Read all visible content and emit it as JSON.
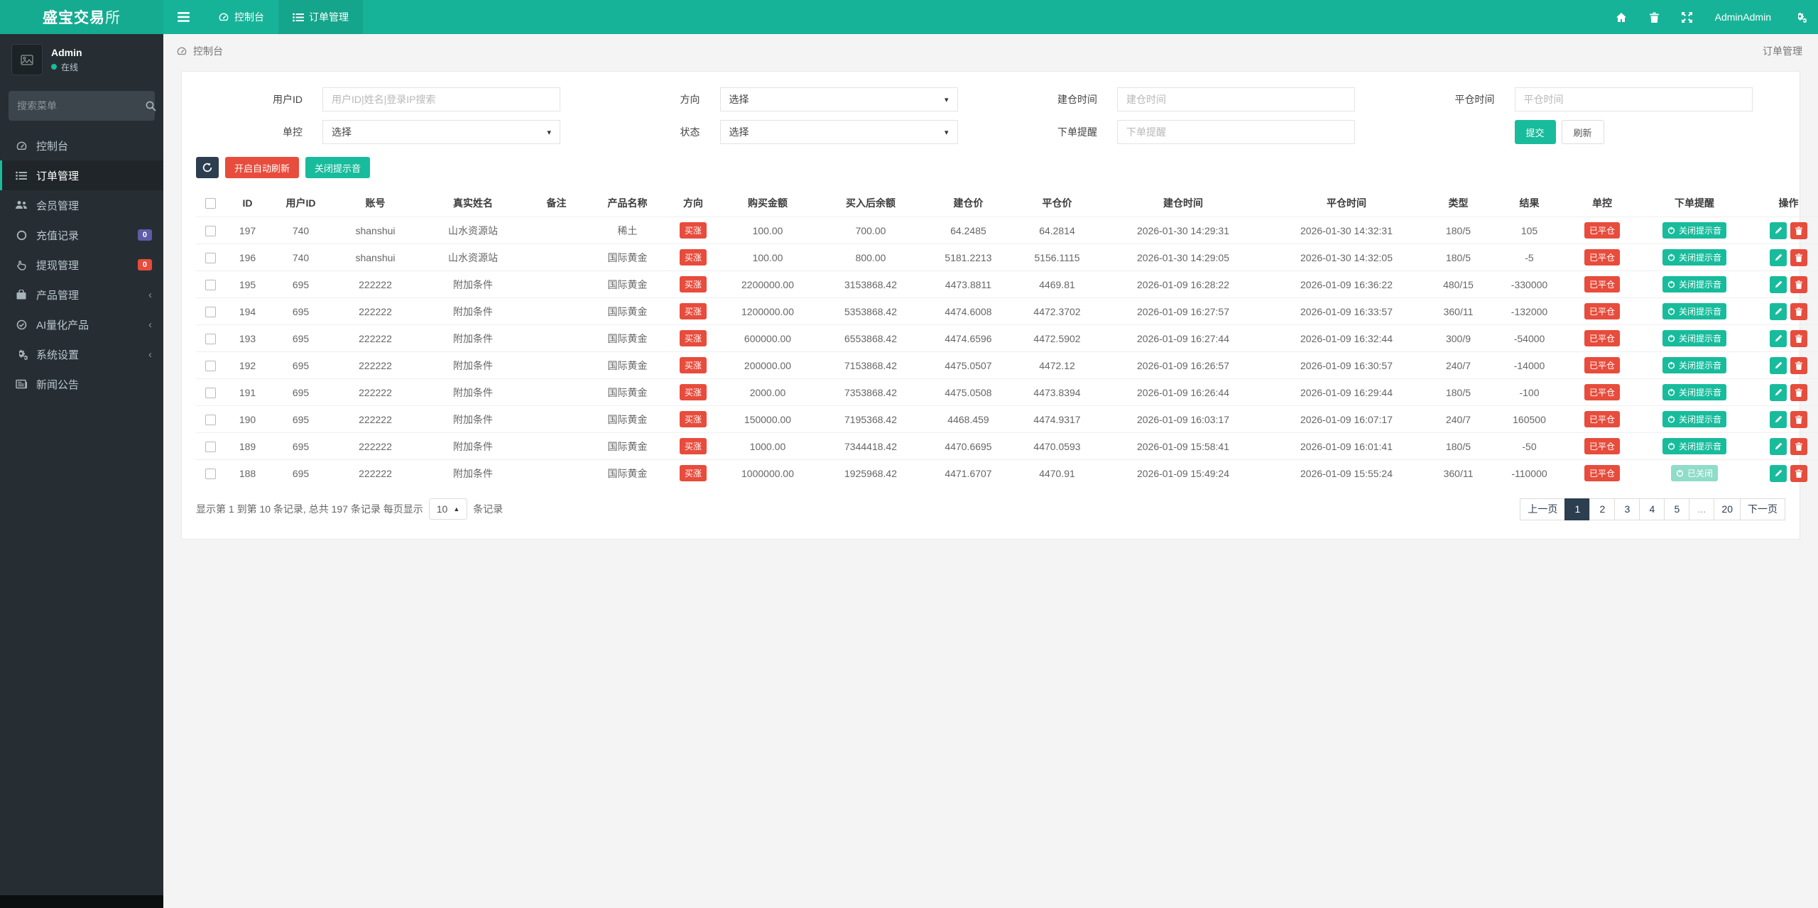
{
  "colors": {
    "teal": "#18bc9c",
    "navbar": "#17b398",
    "navy": "#2c3e50",
    "red": "#e74c3c",
    "purple": "#605ca8",
    "sidebar": "#272e33"
  },
  "brand": {
    "bold": "盛宝交易",
    "light": "所"
  },
  "navbar": {
    "tabs": [
      {
        "label": "控制台"
      },
      {
        "label": "订单管理"
      }
    ],
    "user": "AdminAdmin"
  },
  "profile": {
    "name": "Admin",
    "status": "在线"
  },
  "sidebar": {
    "search_placeholder": "搜索菜单",
    "items": [
      {
        "label": "控制台"
      },
      {
        "label": "订单管理"
      },
      {
        "label": "会员管理"
      },
      {
        "label": "充值记录",
        "badge": "0"
      },
      {
        "label": "提现管理",
        "badge": "0"
      },
      {
        "label": "产品管理"
      },
      {
        "label": "AI量化产品"
      },
      {
        "label": "系统设置"
      },
      {
        "label": "新闻公告"
      }
    ]
  },
  "breadcrumb": {
    "left": "控制台",
    "right": "订单管理"
  },
  "filters": {
    "user_id": {
      "label": "用户ID",
      "placeholder": "用户ID|姓名|登录IP搜索"
    },
    "direction": {
      "label": "方向",
      "value": "选择"
    },
    "open_time": {
      "label": "建仓时间",
      "placeholder": "建仓时间"
    },
    "close_time": {
      "label": "平仓时间",
      "placeholder": "平仓时间"
    },
    "control": {
      "label": "单控",
      "value": "选择"
    },
    "status": {
      "label": "状态",
      "value": "选择"
    },
    "reminder": {
      "label": "下单提醒",
      "placeholder": "下单提醒"
    },
    "submit_label": "提交",
    "refresh_label": "刷新"
  },
  "toolbar": {
    "auto_refresh_label": "开启自动刷新",
    "mute_label": "关闭提示音"
  },
  "table": {
    "columns": [
      "ID",
      "用户ID",
      "账号",
      "真实姓名",
      "备注",
      "产品名称",
      "方向",
      "购买金额",
      "买入后余额",
      "建仓价",
      "平仓价",
      "建仓时间",
      "平仓时间",
      "类型",
      "结果",
      "单控",
      "下单提醒",
      "操作"
    ],
    "rows": [
      {
        "id": "197",
        "user_id": "740",
        "account": "shanshui",
        "real_name": "山水资源站",
        "remark": "",
        "product": "稀土",
        "direction": "买涨",
        "amount": "100.00",
        "balance_after": "700.00",
        "open_price": "64.2485",
        "close_price": "64.2814",
        "open_time": "2026-01-30 14:29:31",
        "close_time": "2026-01-30 14:32:31",
        "type": "180/5",
        "result": "105",
        "control": "已平仓",
        "reminder": "关闭提示音",
        "reminder_state": "on"
      },
      {
        "id": "196",
        "user_id": "740",
        "account": "shanshui",
        "real_name": "山水资源站",
        "remark": "",
        "product": "国际黄金",
        "direction": "买涨",
        "amount": "100.00",
        "balance_after": "800.00",
        "open_price": "5181.2213",
        "close_price": "5156.1115",
        "open_time": "2026-01-30 14:29:05",
        "close_time": "2026-01-30 14:32:05",
        "type": "180/5",
        "result": "-5",
        "control": "已平仓",
        "reminder": "关闭提示音",
        "reminder_state": "on"
      },
      {
        "id": "195",
        "user_id": "695",
        "account": "222222",
        "real_name": "附加条件",
        "remark": "",
        "product": "国际黄金",
        "direction": "买涨",
        "amount": "2200000.00",
        "balance_after": "3153868.42",
        "open_price": "4473.8811",
        "close_price": "4469.81",
        "open_time": "2026-01-09 16:28:22",
        "close_time": "2026-01-09 16:36:22",
        "type": "480/15",
        "result": "-330000",
        "control": "已平仓",
        "reminder": "关闭提示音",
        "reminder_state": "on"
      },
      {
        "id": "194",
        "user_id": "695",
        "account": "222222",
        "real_name": "附加条件",
        "remark": "",
        "product": "国际黄金",
        "direction": "买涨",
        "amount": "1200000.00",
        "balance_after": "5353868.42",
        "open_price": "4474.6008",
        "close_price": "4472.3702",
        "open_time": "2026-01-09 16:27:57",
        "close_time": "2026-01-09 16:33:57",
        "type": "360/11",
        "result": "-132000",
        "control": "已平仓",
        "reminder": "关闭提示音",
        "reminder_state": "on"
      },
      {
        "id": "193",
        "user_id": "695",
        "account": "222222",
        "real_name": "附加条件",
        "remark": "",
        "product": "国际黄金",
        "direction": "买涨",
        "amount": "600000.00",
        "balance_after": "6553868.42",
        "open_price": "4474.6596",
        "close_price": "4472.5902",
        "open_time": "2026-01-09 16:27:44",
        "close_time": "2026-01-09 16:32:44",
        "type": "300/9",
        "result": "-54000",
        "control": "已平仓",
        "reminder": "关闭提示音",
        "reminder_state": "on"
      },
      {
        "id": "192",
        "user_id": "695",
        "account": "222222",
        "real_name": "附加条件",
        "remark": "",
        "product": "国际黄金",
        "direction": "买涨",
        "amount": "200000.00",
        "balance_after": "7153868.42",
        "open_price": "4475.0507",
        "close_price": "4472.12",
        "open_time": "2026-01-09 16:26:57",
        "close_time": "2026-01-09 16:30:57",
        "type": "240/7",
        "result": "-14000",
        "control": "已平仓",
        "reminder": "关闭提示音",
        "reminder_state": "on"
      },
      {
        "id": "191",
        "user_id": "695",
        "account": "222222",
        "real_name": "附加条件",
        "remark": "",
        "product": "国际黄金",
        "direction": "买涨",
        "amount": "2000.00",
        "balance_after": "7353868.42",
        "open_price": "4475.0508",
        "close_price": "4473.8394",
        "open_time": "2026-01-09 16:26:44",
        "close_time": "2026-01-09 16:29:44",
        "type": "180/5",
        "result": "-100",
        "control": "已平仓",
        "reminder": "关闭提示音",
        "reminder_state": "on"
      },
      {
        "id": "190",
        "user_id": "695",
        "account": "222222",
        "real_name": "附加条件",
        "remark": "",
        "product": "国际黄金",
        "direction": "买涨",
        "amount": "150000.00",
        "balance_after": "7195368.42",
        "open_price": "4468.459",
        "close_price": "4474.9317",
        "open_time": "2026-01-09 16:03:17",
        "close_time": "2026-01-09 16:07:17",
        "type": "240/7",
        "result": "160500",
        "control": "已平仓",
        "reminder": "关闭提示音",
        "reminder_state": "on"
      },
      {
        "id": "189",
        "user_id": "695",
        "account": "222222",
        "real_name": "附加条件",
        "remark": "",
        "product": "国际黄金",
        "direction": "买涨",
        "amount": "1000.00",
        "balance_after": "7344418.42",
        "open_price": "4470.6695",
        "close_price": "4470.0593",
        "open_time": "2026-01-09 15:58:41",
        "close_time": "2026-01-09 16:01:41",
        "type": "180/5",
        "result": "-50",
        "control": "已平仓",
        "reminder": "关闭提示音",
        "reminder_state": "on"
      },
      {
        "id": "188",
        "user_id": "695",
        "account": "222222",
        "real_name": "附加条件",
        "remark": "",
        "product": "国际黄金",
        "direction": "买涨",
        "amount": "1000000.00",
        "balance_after": "1925968.42",
        "open_price": "4471.6707",
        "close_price": "4470.91",
        "open_time": "2026-01-09 15:49:24",
        "close_time": "2026-01-09 15:55:24",
        "type": "360/11",
        "result": "-110000",
        "control": "已平仓",
        "reminder": "已关闭",
        "reminder_state": "off"
      }
    ]
  },
  "footer": {
    "summary": "显示第 1 到第 10 条记录, 总共 197 条记录 每页显示",
    "page_size": "10",
    "suffix": "条记录"
  },
  "pagination": {
    "prev": "上一页",
    "next": "下一页",
    "pages": [
      "1",
      "2",
      "3",
      "4",
      "5",
      "...",
      "20"
    ],
    "active": "1"
  }
}
